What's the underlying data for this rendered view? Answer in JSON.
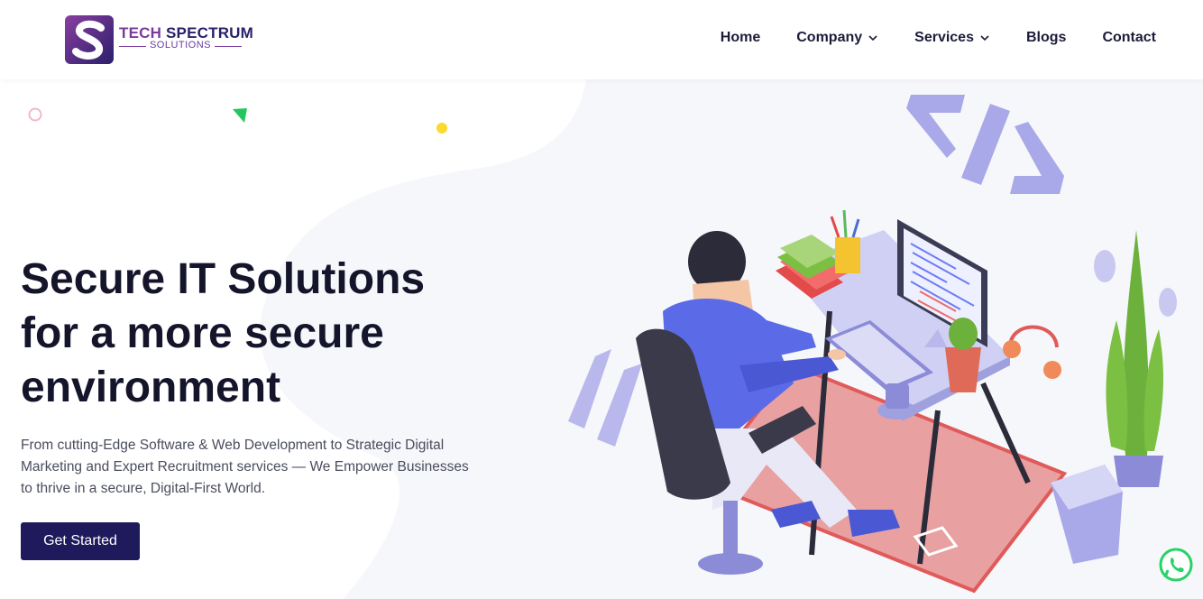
{
  "brand": {
    "name_part1": "TECH",
    "name_part2": "SPECTRUM",
    "tagline": "SOLUTIONS"
  },
  "nav": {
    "items": [
      {
        "label": "Home",
        "has_dropdown": false
      },
      {
        "label": "Company",
        "has_dropdown": true
      },
      {
        "label": "Services",
        "has_dropdown": true
      },
      {
        "label": "Blogs",
        "has_dropdown": false
      },
      {
        "label": "Contact",
        "has_dropdown": false
      }
    ]
  },
  "hero": {
    "title_line1": "Secure IT Solutions",
    "title_line2": "for a more secure",
    "title_line3": "environment",
    "description_line1": "From cutting-Edge Software & Web Development to Strategic Digital",
    "description_line2": "Marketing and Expert Recruitment services — We Empower Businesses",
    "description_line3": "to thrive in a secure, Digital-First World.",
    "cta_label": "Get Started"
  },
  "colors": {
    "primary": "#1f1a5c",
    "brand_purple": "#7a3a9c",
    "accent_lavender": "#a9a8e8",
    "whatsapp": "#25d366"
  },
  "icons": {
    "logo": "brand-s-logo",
    "chevron": "chevron-down-icon",
    "floating": "whatsapp-icon"
  }
}
